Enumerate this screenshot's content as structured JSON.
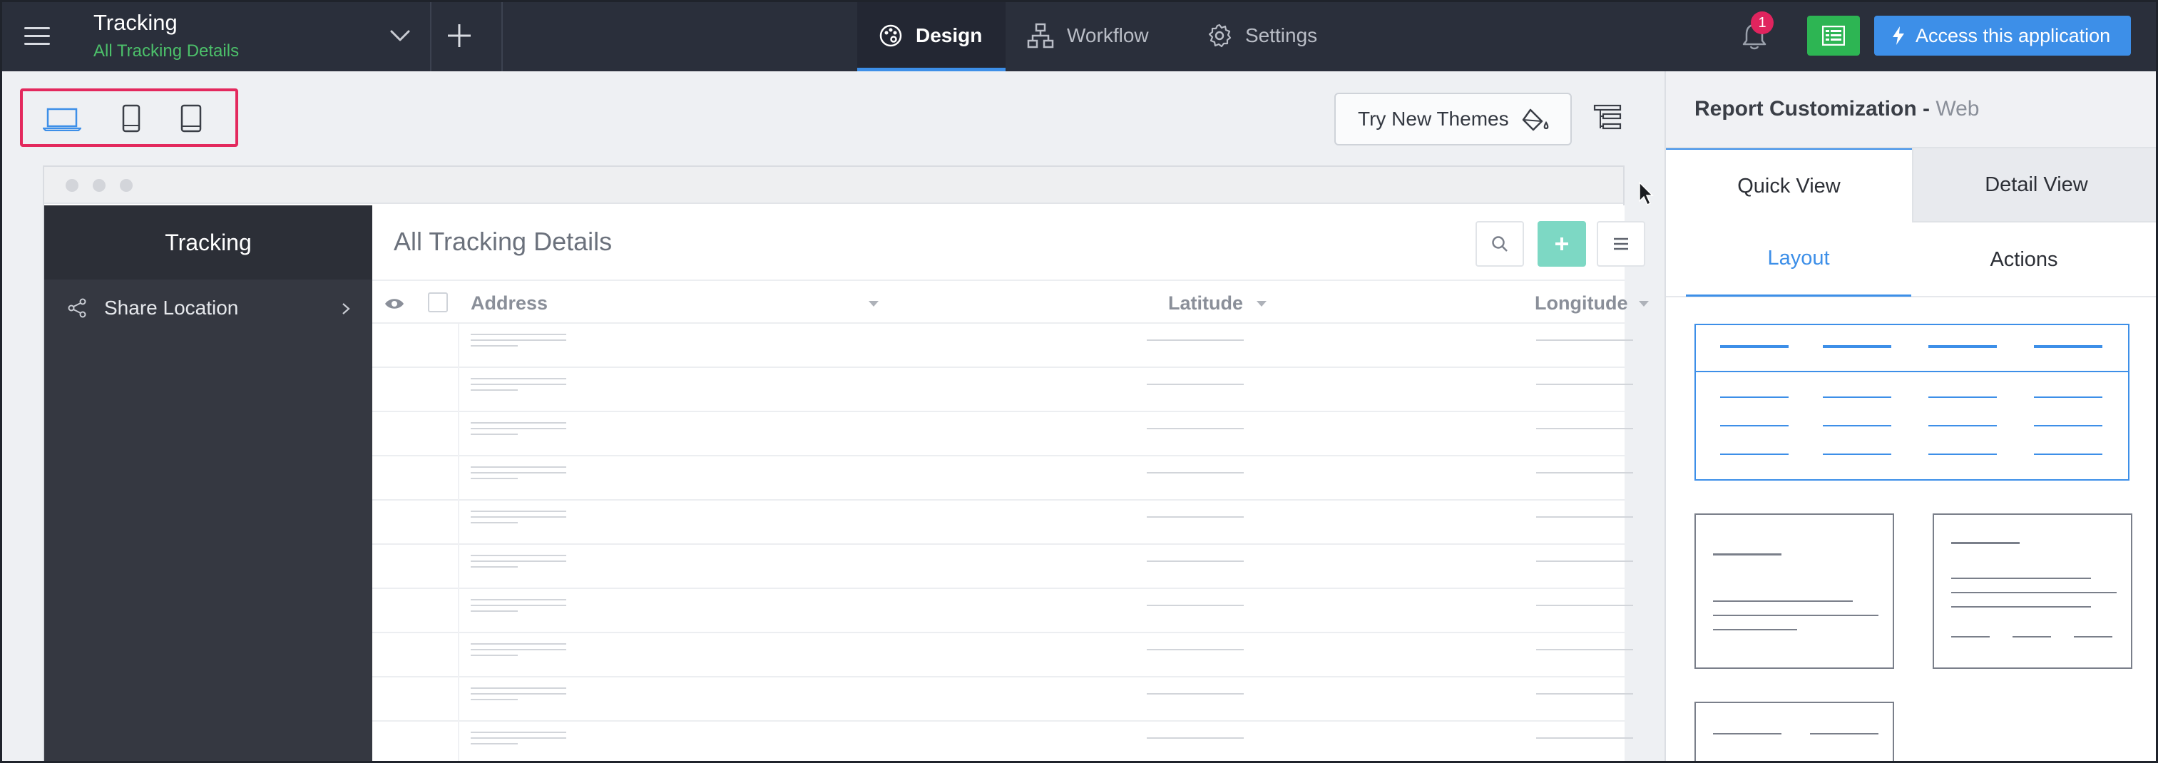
{
  "app": {
    "title": "Tracking",
    "subtitle": "All Tracking Details"
  },
  "nav": {
    "tabs": [
      {
        "label": "Design",
        "icon": "palette-icon",
        "active": true
      },
      {
        "label": "Workflow",
        "icon": "workflow-icon",
        "active": false
      },
      {
        "label": "Settings",
        "icon": "gear-icon",
        "active": false
      }
    ],
    "notification_count": "1",
    "access_label": "Access this application"
  },
  "toolbar": {
    "devices": [
      "laptop-icon",
      "tablet-icon",
      "mobile-icon"
    ],
    "themes_label": "Try New Themes"
  },
  "preview": {
    "sidebar_title": "Tracking",
    "sidebar_items": [
      {
        "label": "Share Location",
        "icon": "share-icon"
      }
    ],
    "report_title": "All Tracking Details",
    "columns": [
      "Address",
      "Latitude",
      "Longitude"
    ],
    "row_count": 10
  },
  "panel": {
    "title": "Report Customization",
    "title_suffix": "Web",
    "view_tabs": [
      "Quick View",
      "Detail View"
    ],
    "sub_tabs": [
      "Layout",
      "Actions"
    ]
  },
  "colors": {
    "topbar": "#2a2f3b",
    "accent": "#3d8fe8",
    "green": "#2db553",
    "highlight": "#e3295d",
    "add_button": "#7dd8c4"
  }
}
